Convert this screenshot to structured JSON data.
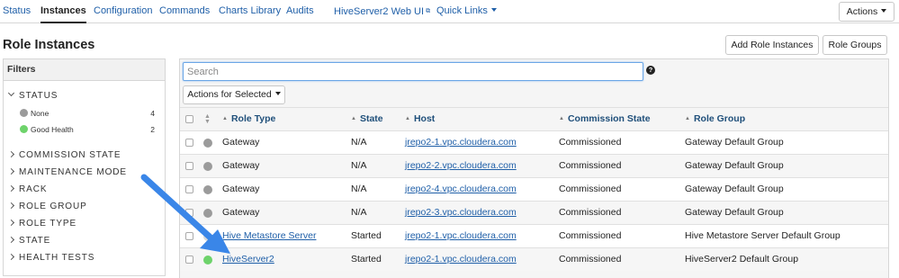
{
  "nav": {
    "tabs": [
      {
        "label": "Status"
      },
      {
        "label": "Instances",
        "active": true
      },
      {
        "label": "Configuration"
      },
      {
        "label": "Commands"
      },
      {
        "label": "Charts Library"
      },
      {
        "label": "Audits"
      },
      {
        "label": "HiveServer2 Web UI",
        "icon": "external-link-icon"
      },
      {
        "label": "Quick Links",
        "icon": "caret-down-icon"
      }
    ],
    "actions_label": "Actions"
  },
  "page": {
    "title": "Role Instances",
    "add_role_instances_label": "Add Role Instances",
    "role_groups_label": "Role Groups"
  },
  "filters": {
    "title": "Filters",
    "status": {
      "label": "STATUS",
      "options": [
        {
          "label": "None",
          "count": "4",
          "color": "#9b9b9b"
        },
        {
          "label": "Good Health",
          "count": "2",
          "color": "#6ed36b"
        }
      ]
    },
    "groups": [
      "COMMISSION STATE",
      "MAINTENANCE MODE",
      "RACK",
      "ROLE GROUP",
      "ROLE TYPE",
      "STATE",
      "HEALTH TESTS"
    ]
  },
  "main": {
    "search_placeholder": "Search",
    "actions_for_selected_label": "Actions for Selected",
    "columns": [
      "Role Type",
      "State",
      "Host",
      "Commission State",
      "Role Group"
    ],
    "rows": [
      {
        "role_type": "Gateway",
        "state": "N/A",
        "host": "jrepo2-1.vpc.cloudera.com",
        "commission_state": "Commissioned",
        "role_group": "Gateway Default Group",
        "status_color": "#9b9b9b"
      },
      {
        "role_type": "Gateway",
        "state": "N/A",
        "host": "jrepo2-2.vpc.cloudera.com",
        "commission_state": "Commissioned",
        "role_group": "Gateway Default Group",
        "status_color": "#9b9b9b"
      },
      {
        "role_type": "Gateway",
        "state": "N/A",
        "host": "jrepo2-4.vpc.cloudera.com",
        "commission_state": "Commissioned",
        "role_group": "Gateway Default Group",
        "status_color": "#9b9b9b"
      },
      {
        "role_type": "Gateway",
        "state": "N/A",
        "host": "jrepo2-3.vpc.cloudera.com",
        "commission_state": "Commissioned",
        "role_group": "Gateway Default Group",
        "status_color": "#9b9b9b"
      },
      {
        "role_type": "Hive Metastore Server",
        "state": "Started",
        "host": "jrepo2-1.vpc.cloudera.com",
        "commission_state": "Commissioned",
        "role_group": "Hive Metastore Server Default Group",
        "status_color": "#d8d8d8"
      },
      {
        "role_type": "HiveServer2",
        "state": "Started",
        "host": "jrepo2-1.vpc.cloudera.com",
        "commission_state": "Commissioned",
        "role_group": "HiveServer2 Default Group",
        "status_color": "#6ed36b"
      }
    ]
  },
  "colors": {
    "link": "#1f5fa8",
    "annotation_arrow": "#3a86e8"
  }
}
